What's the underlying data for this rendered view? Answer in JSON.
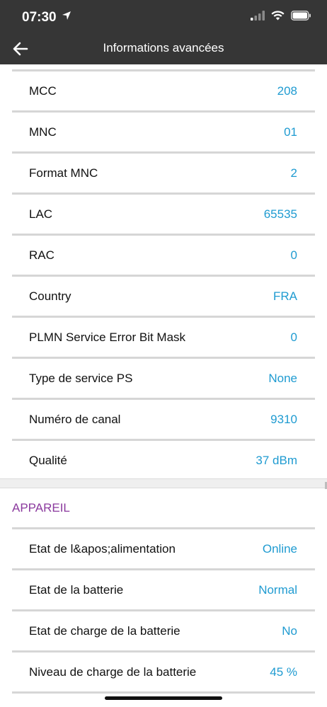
{
  "status_bar": {
    "time": "07:30"
  },
  "nav": {
    "title": "Informations avancées"
  },
  "network_rows": [
    {
      "label": "MCC",
      "value": "208"
    },
    {
      "label": "MNC",
      "value": "01"
    },
    {
      "label": "Format MNC",
      "value": "2"
    },
    {
      "label": "LAC",
      "value": "65535"
    },
    {
      "label": "RAC",
      "value": "0"
    },
    {
      "label": "Country",
      "value": "FRA"
    },
    {
      "label": "PLMN Service Error Bit Mask",
      "value": "0"
    },
    {
      "label": "Type de service PS",
      "value": "None"
    },
    {
      "label": "Numéro de canal",
      "value": "9310"
    },
    {
      "label": "Qualité",
      "value": "37 dBm"
    }
  ],
  "device_section": {
    "header": "APPAREIL",
    "rows": [
      {
        "label": "Etat de l&apos;alimentation",
        "value": "Online"
      },
      {
        "label": "Etat de la batterie",
        "value": "Normal"
      },
      {
        "label": "Etat de charge de la batterie",
        "value": "No"
      },
      {
        "label": "Niveau de charge de la batterie",
        "value": "45 %"
      }
    ]
  },
  "colors": {
    "bar": "#363636",
    "value": "#1f9bd1",
    "section": "#8b3a9e"
  }
}
